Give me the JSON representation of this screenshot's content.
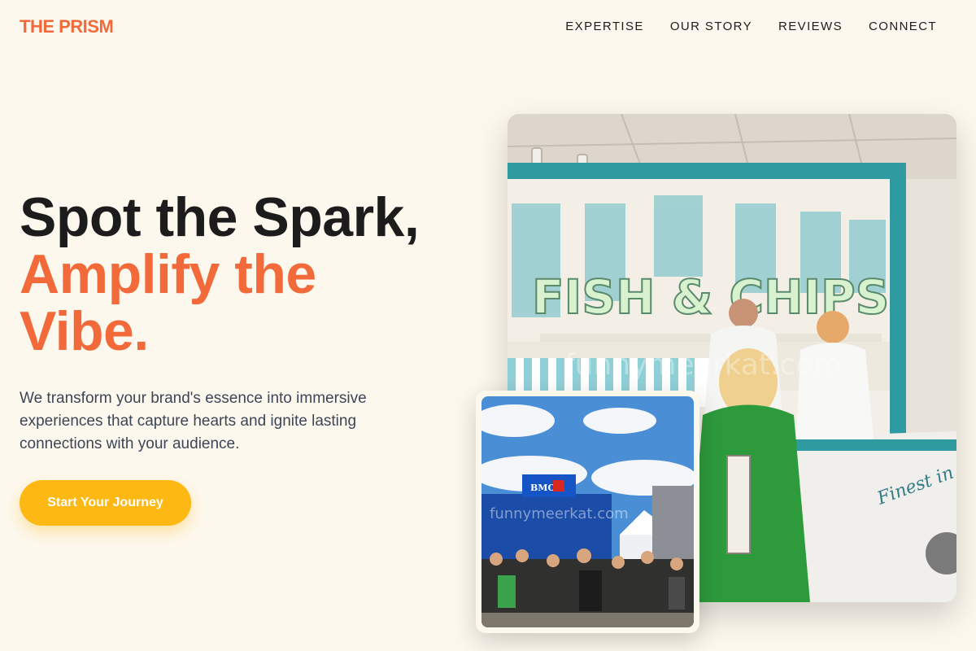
{
  "brand": {
    "name": "THE PRISM"
  },
  "nav": {
    "items": [
      {
        "label": "EXPERTISE"
      },
      {
        "label": "OUR STORY"
      },
      {
        "label": "REVIEWS"
      },
      {
        "label": "CONNECT"
      }
    ]
  },
  "hero": {
    "title_line1": "Spot the Spark,",
    "title_line2": "Amplify the",
    "title_line3": "Vibe.",
    "subtitle": "We transform your brand's essence into immersive experiences that capture hearts and ignite lasting connections with your audience.",
    "cta_label": "Start Your Journey"
  },
  "images": {
    "main": {
      "sign_text": "FISH & CHIPS",
      "counter_text": "Finest in London",
      "watermark": "funnymeerkat.com"
    },
    "secondary": {
      "banner_text": "BMO",
      "watermark": "funnymeerkat.com"
    }
  },
  "colors": {
    "background": "#fdf8ee",
    "accent": "#f26a3a",
    "cta": "#fdb813",
    "text_dark": "#1c1c1c",
    "text_body": "#3d4656"
  }
}
